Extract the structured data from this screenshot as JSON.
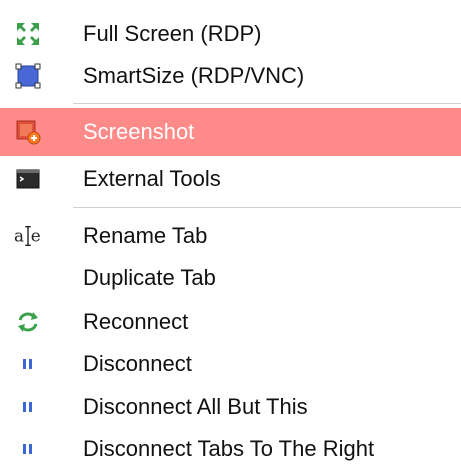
{
  "menu": {
    "items": [
      {
        "label": "Full Screen (RDP)",
        "icon": "fullscreen-icon"
      },
      {
        "label": "SmartSize (RDP/VNC)",
        "icon": "smartsize-icon"
      },
      {
        "label": "Screenshot",
        "icon": "screenshot-icon",
        "highlighted": true
      },
      {
        "label": "External Tools",
        "icon": "terminal-icon"
      },
      {
        "label": "Rename Tab",
        "icon": "rename-icon"
      },
      {
        "label": "Duplicate Tab",
        "icon": ""
      },
      {
        "label": "Reconnect",
        "icon": "refresh-icon"
      },
      {
        "label": "Disconnect",
        "icon": "pause-icon"
      },
      {
        "label": "Disconnect All But This",
        "icon": "pause-icon"
      },
      {
        "label": "Disconnect Tabs To The Right",
        "icon": "pause-icon"
      }
    ],
    "colors": {
      "highlight_bg": "#ff8a8a",
      "highlight_text": "#ffffff",
      "text": "#111111",
      "separator": "#cfcfcf"
    }
  }
}
